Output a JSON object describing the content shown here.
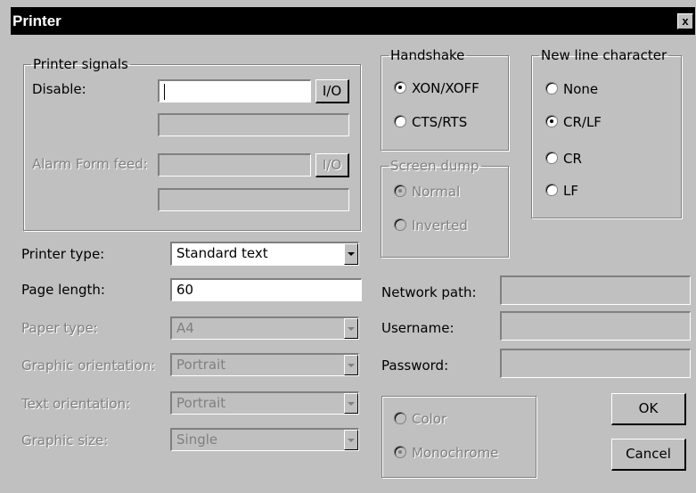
{
  "window": {
    "title": "Printer",
    "close_glyph": "x"
  },
  "printer_signals": {
    "legend": "Printer signals",
    "disable_label": "Disable:",
    "disable_value": "",
    "io_button": "I/O",
    "alarm_label": "Alarm Form feed:",
    "alarm_io_button": "I/O"
  },
  "handshake": {
    "legend": "Handshake",
    "options": [
      "XON/XOFF",
      "CTS/RTS"
    ],
    "selected": "XON/XOFF"
  },
  "new_line": {
    "legend": "New line character",
    "options": [
      "None",
      "CR/LF",
      "CR",
      "LF"
    ],
    "selected": "CR/LF"
  },
  "screen_dump": {
    "legend": "Screen dump",
    "options": [
      "Normal",
      "Inverted"
    ],
    "selected": "Normal"
  },
  "form": {
    "printer_type_label": "Printer type:",
    "printer_type_value": "Standard text",
    "page_length_label": "Page length:",
    "page_length_value": "60",
    "paper_type_label": "Paper type:",
    "paper_type_value": "A4",
    "graphic_orientation_label": "Graphic orientation:",
    "graphic_orientation_value": "Portrait",
    "text_orientation_label": "Text orientation:",
    "text_orientation_value": "Portrait",
    "graphic_size_label": "Graphic size:",
    "graphic_size_value": "Single"
  },
  "network": {
    "path_label": "Network path:",
    "username_label": "Username:",
    "password_label": "Password:"
  },
  "color_mode": {
    "options": [
      "Color",
      "Monochrome"
    ],
    "selected": "Monochrome"
  },
  "buttons": {
    "ok": "OK",
    "cancel": "Cancel"
  }
}
